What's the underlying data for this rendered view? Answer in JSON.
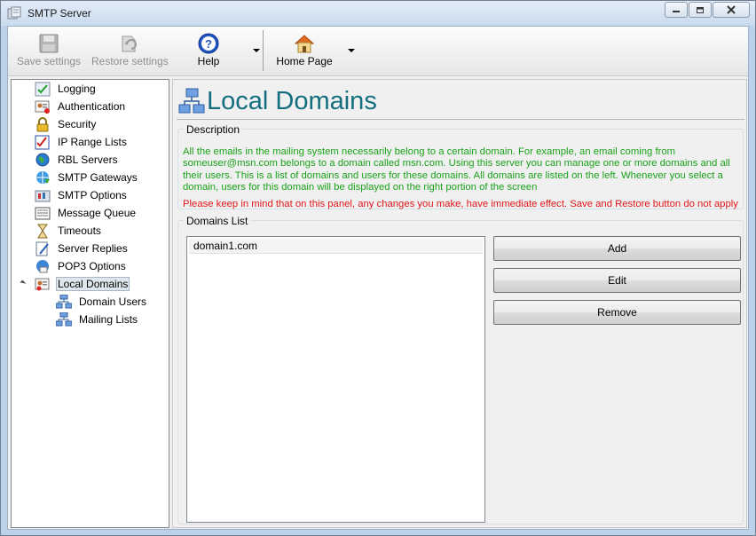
{
  "window": {
    "title": "SMTP Server"
  },
  "toolbar": {
    "save_label": "Save settings",
    "restore_label": "Restore settings",
    "help_label": "Help",
    "home_label": "Home Page"
  },
  "tree": {
    "items": [
      {
        "label": "Logging",
        "icon": "logging-icon"
      },
      {
        "label": "Authentication",
        "icon": "authentication-icon"
      },
      {
        "label": "Security",
        "icon": "lock-icon"
      },
      {
        "label": "IP Range Lists",
        "icon": "ip-range-icon"
      },
      {
        "label": "RBL Servers",
        "icon": "globe-icon"
      },
      {
        "label": "SMTP Gateways",
        "icon": "gateway-icon"
      },
      {
        "label": "SMTP Options",
        "icon": "options-icon"
      },
      {
        "label": "Message Queue",
        "icon": "queue-icon"
      },
      {
        "label": "Timeouts",
        "icon": "timer-icon"
      },
      {
        "label": "Server Replies",
        "icon": "replies-icon"
      },
      {
        "label": "POP3 Options",
        "icon": "pop3-icon"
      },
      {
        "label": "Local Domains",
        "icon": "local-domains-icon"
      }
    ],
    "children": [
      {
        "label": "Domain Users",
        "icon": "network-icon"
      },
      {
        "label": "Mailing Lists",
        "icon": "network-icon"
      }
    ]
  },
  "panel": {
    "title": "Local Domains",
    "description_legend": "Description",
    "description": "All the emails in the mailing system necessarily belong to a certain domain. For example, an email coming from someuser@msn.com belongs to a domain called msn.com. Using this server you can manage one or more domains and all their users. This is a list of domains and users for these domains. All domains are listed on the left. Whenever you select a domain, users for this domain will be displayed on the right portion of the screen",
    "warning": "Please keep in mind that on this panel, any changes you make, have immediate effect. Save and Restore button do not apply",
    "domains_legend": "Domains List",
    "domains": [
      "domain1.com"
    ],
    "add_label": "Add",
    "edit_label": "Edit",
    "remove_label": "Remove"
  },
  "colors": {
    "title_teal": "#136e80",
    "description_green": "#1aa21a",
    "warning_red": "#e2161a"
  }
}
